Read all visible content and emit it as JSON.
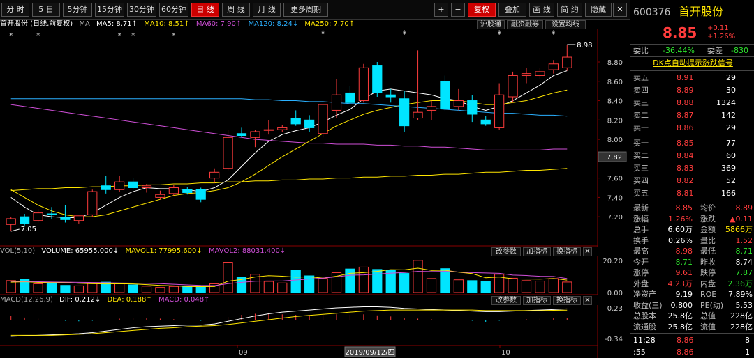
{
  "toolbar": {
    "periods": [
      "分 时",
      "5 日",
      "5分钟",
      "15分钟",
      "30分钟",
      "60分钟",
      "日 线",
      "周 线",
      "月 线",
      "更多周期"
    ],
    "active_period": "日 线",
    "right_buttons": [
      "+",
      "−",
      "复权",
      "叠加",
      "画 线",
      "简 约",
      "隐藏"
    ]
  },
  "main_header": {
    "stock_title": "首开股份 (日线,前复权)",
    "ma_label": "MA",
    "ma5": "MA5: 8.71",
    "ma10": "MA10: 8.51",
    "ma60": "MA60: 7.90",
    "ma120": "MA120: 8.24",
    "ma250": "MA250: 7.70",
    "buttons": [
      "沪股通",
      "融资融券",
      "设置均线"
    ]
  },
  "vol_header": {
    "title": "VOL(5,10)",
    "volume": "VOLUME: 65955.000",
    "mavol1": "MAVOL1: 77995.600",
    "mavol2": "MAVOL2: 88031.400",
    "buttons": [
      "改参数",
      "加指标",
      "换指标",
      "✕"
    ]
  },
  "macd_header": {
    "title": "MACD(12,26,9)",
    "dif": "DIF: 0.212",
    "dea": "DEA: 0.188",
    "macd": "MACD: 0.048",
    "buttons": [
      "改参数",
      "加指标",
      "换指标",
      "✕"
    ]
  },
  "axis": {
    "price_ticks": [
      "8.80",
      "8.60",
      "8.40",
      "8.20",
      "8.00",
      "7.80",
      "7.60",
      "7.40",
      "7.20"
    ],
    "current_tag": "7.82",
    "vol_ticks": [
      "20.20",
      "0.00"
    ],
    "macd_ticks": [
      "0.23",
      "-0.34"
    ],
    "date_labels": [
      "09",
      "10"
    ],
    "date_cursor": "2019/09/12/四",
    "high_mark": "8.98",
    "low_mark": "7.05"
  },
  "colors": {
    "up": "#ff3c3c",
    "down": "#00e5ff",
    "ma5": "#ffffff",
    "ma10": "#ffe600",
    "ma60": "#d04fd8",
    "ma120": "#2ab0ff",
    "ma250": "#ffe600"
  },
  "right_panel": {
    "code": "600376",
    "name": "首开股份",
    "price": "8.85",
    "change": "+0.11",
    "change_pct": "+1.26%",
    "weibi_label": "委比",
    "weibi": "-36.44%",
    "weicha_label": "委差",
    "weicha": "-830",
    "signal_link": "DK点自动提示涨跌信号",
    "asks": [
      {
        "label": "卖五",
        "price": "8.91",
        "vol": "29"
      },
      {
        "label": "卖四",
        "price": "8.89",
        "vol": "30"
      },
      {
        "label": "卖三",
        "price": "8.88",
        "vol": "1324"
      },
      {
        "label": "卖二",
        "price": "8.87",
        "vol": "142"
      },
      {
        "label": "卖一",
        "price": "8.86",
        "vol": "29"
      }
    ],
    "bids": [
      {
        "label": "买一",
        "price": "8.85",
        "vol": "77"
      },
      {
        "label": "买二",
        "price": "8.84",
        "vol": "60"
      },
      {
        "label": "买三",
        "price": "8.83",
        "vol": "369"
      },
      {
        "label": "买四",
        "price": "8.82",
        "vol": "52"
      },
      {
        "label": "买五",
        "price": "8.81",
        "vol": "166"
      }
    ],
    "quote": [
      {
        "l1": "最新",
        "v1": "8.85",
        "c1": "red",
        "l2": "均价",
        "v2": "8.89",
        "c2": "red"
      },
      {
        "l1": "涨幅",
        "v1": "+1.26%",
        "c1": "red",
        "l2": "涨跌",
        "v2": "▲0.11",
        "c2": "red"
      },
      {
        "l1": "总手",
        "v1": "6.60万",
        "c1": "white",
        "l2": "金额",
        "v2": "5866万",
        "c2": "yellow"
      },
      {
        "l1": "换手",
        "v1": "0.26%",
        "c1": "white",
        "l2": "量比",
        "v2": "1.52",
        "c2": "red"
      },
      {
        "l1": "最高",
        "v1": "8.98",
        "c1": "red",
        "l2": "最低",
        "v2": "8.71",
        "c2": "green"
      },
      {
        "l1": "今开",
        "v1": "8.71",
        "c1": "green",
        "l2": "昨收",
        "v2": "8.74",
        "c2": "white"
      },
      {
        "l1": "涨停",
        "v1": "9.61",
        "c1": "red",
        "l2": "跌停",
        "v2": "7.87",
        "c2": "green"
      },
      {
        "l1": "外盘",
        "v1": "4.23万",
        "c1": "red",
        "l2": "内盘",
        "v2": "2.36万",
        "c2": "green"
      },
      {
        "l1": "净资产",
        "v1": "9.19",
        "c1": "white",
        "l2": "ROE",
        "v2": "7.89%",
        "c2": "white"
      },
      {
        "l1": "收益(三)",
        "v1": "0.800",
        "c1": "white",
        "l2": "PE(动)",
        "v2": "5.53",
        "c2": "white"
      },
      {
        "l1": "总股本",
        "v1": "25.8亿",
        "c1": "white",
        "l2": "总值",
        "v2": "228亿",
        "c2": "white"
      },
      {
        "l1": "流通股",
        "v1": "25.8亿",
        "c1": "white",
        "l2": "流值",
        "v2": "228亿",
        "c2": "white"
      }
    ],
    "ticks": [
      {
        "time": "11:28",
        "price": "8.86",
        "vol": "8"
      },
      {
        "time": ":55",
        "price": "8.86",
        "vol": "1"
      }
    ]
  },
  "chart_data": {
    "type": "candlestick",
    "title": "首开股份 (日线,前复权)",
    "ylim": [
      7.05,
      9.0
    ],
    "dates_visible": [
      "09",
      "2019/09/12/四",
      "10"
    ],
    "candles": [
      {
        "o": 7.12,
        "h": 7.2,
        "l": 7.05,
        "c": 7.18
      },
      {
        "o": 7.2,
        "h": 7.23,
        "l": 7.11,
        "c": 7.13
      },
      {
        "o": 7.16,
        "h": 7.28,
        "l": 7.14,
        "c": 7.24
      },
      {
        "o": 7.23,
        "h": 7.3,
        "l": 7.18,
        "c": 7.22
      },
      {
        "o": 7.19,
        "h": 7.32,
        "l": 7.14,
        "c": 7.17
      },
      {
        "o": 7.16,
        "h": 7.21,
        "l": 7.13,
        "c": 7.21
      },
      {
        "o": 7.22,
        "h": 7.48,
        "l": 7.2,
        "c": 7.46
      },
      {
        "o": 7.52,
        "h": 7.62,
        "l": 7.44,
        "c": 7.48
      },
      {
        "o": 7.48,
        "h": 7.62,
        "l": 7.46,
        "c": 7.56
      },
      {
        "o": 7.56,
        "h": 7.6,
        "l": 7.48,
        "c": 7.5
      },
      {
        "o": 7.5,
        "h": 7.54,
        "l": 7.45,
        "c": 7.52
      },
      {
        "o": 7.4,
        "h": 7.47,
        "l": 7.38,
        "c": 7.43
      },
      {
        "o": 7.44,
        "h": 7.53,
        "l": 7.42,
        "c": 7.5
      },
      {
        "o": 7.48,
        "h": 7.51,
        "l": 7.43,
        "c": 7.45
      },
      {
        "o": 7.48,
        "h": 7.5,
        "l": 7.35,
        "c": 7.38
      },
      {
        "o": 7.6,
        "h": 7.7,
        "l": 7.55,
        "c": 7.66
      },
      {
        "o": 7.7,
        "h": 8.1,
        "l": 7.68,
        "c": 8.02
      },
      {
        "o": 8.06,
        "h": 8.12,
        "l": 8.02,
        "c": 8.04
      },
      {
        "o": 8.02,
        "h": 8.1,
        "l": 7.92,
        "c": 8.08
      },
      {
        "o": 8.1,
        "h": 8.2,
        "l": 8.05,
        "c": 8.1
      },
      {
        "o": 8.1,
        "h": 8.15,
        "l": 8.08,
        "c": 8.12
      },
      {
        "o": 8.22,
        "h": 8.3,
        "l": 8.14,
        "c": 8.16
      },
      {
        "o": 8.2,
        "h": 8.25,
        "l": 8.08,
        "c": 8.12
      },
      {
        "o": 8.06,
        "h": 8.34,
        "l": 8.02,
        "c": 8.36
      },
      {
        "o": 8.3,
        "h": 8.62,
        "l": 8.22,
        "c": 8.46
      },
      {
        "o": 8.48,
        "h": 8.55,
        "l": 8.4,
        "c": 8.38
      },
      {
        "o": 8.4,
        "h": 8.78,
        "l": 8.38,
        "c": 8.74
      },
      {
        "o": 8.76,
        "h": 8.8,
        "l": 8.44,
        "c": 8.48
      },
      {
        "o": 8.46,
        "h": 8.52,
        "l": 8.38,
        "c": 8.44
      },
      {
        "o": 8.42,
        "h": 8.5,
        "l": 8.08,
        "c": 8.14
      },
      {
        "o": 8.22,
        "h": 8.92,
        "l": 8.2,
        "c": 8.28
      },
      {
        "o": 8.3,
        "h": 8.4,
        "l": 8.2,
        "c": 8.34
      },
      {
        "o": 8.6,
        "h": 8.66,
        "l": 8.3,
        "c": 8.32
      },
      {
        "o": 8.34,
        "h": 8.52,
        "l": 8.3,
        "c": 8.4
      },
      {
        "o": 8.4,
        "h": 8.46,
        "l": 8.18,
        "c": 8.26
      },
      {
        "o": 8.2,
        "h": 8.24,
        "l": 8.14,
        "c": 8.16
      },
      {
        "o": 8.12,
        "h": 8.58,
        "l": 8.1,
        "c": 8.46
      },
      {
        "o": 8.44,
        "h": 8.7,
        "l": 8.38,
        "c": 8.66
      },
      {
        "o": 8.66,
        "h": 8.74,
        "l": 8.58,
        "c": 8.68
      },
      {
        "o": 8.66,
        "h": 8.74,
        "l": 8.62,
        "c": 8.7
      },
      {
        "o": 8.72,
        "h": 8.82,
        "l": 8.68,
        "c": 8.78
      },
      {
        "o": 8.74,
        "h": 8.98,
        "l": 8.71,
        "c": 8.85
      }
    ],
    "ma_lines": [
      {
        "name": "MA5",
        "values": [
          7.4,
          7.3,
          7.22,
          7.2,
          7.19,
          7.19,
          7.24,
          7.32,
          7.4,
          7.46,
          7.5,
          7.49,
          7.49,
          7.48,
          7.46,
          7.5,
          7.58,
          7.72,
          7.86,
          7.98,
          8.05,
          8.09,
          8.12,
          8.18,
          8.25,
          8.31,
          8.42,
          8.5,
          8.52,
          8.5,
          8.48,
          8.46,
          8.42,
          8.4,
          8.34,
          8.3,
          8.34,
          8.4,
          8.48,
          8.56,
          8.66,
          8.71
        ]
      },
      {
        "name": "MA10",
        "values": [
          7.48,
          7.4,
          7.32,
          7.26,
          7.22,
          7.2,
          7.2,
          7.22,
          7.26,
          7.3,
          7.34,
          7.38,
          7.42,
          7.44,
          7.45,
          7.47,
          7.5,
          7.56,
          7.64,
          7.73,
          7.82,
          7.9,
          7.98,
          8.06,
          8.14,
          8.2,
          8.26,
          8.3,
          8.33,
          8.36,
          8.38,
          8.4,
          8.4,
          8.4,
          8.38,
          8.36,
          8.36,
          8.38,
          8.4,
          8.44,
          8.48,
          8.51
        ]
      },
      {
        "name": "MA60",
        "values": [
          8.36,
          8.34,
          8.32,
          8.3,
          8.28,
          8.26,
          8.24,
          8.22,
          8.2,
          8.18,
          8.16,
          8.14,
          8.12,
          8.1,
          8.08,
          8.06,
          8.04,
          8.02,
          8.0,
          7.99,
          7.98,
          7.97,
          7.96,
          7.96,
          7.95,
          7.95,
          7.95,
          7.94,
          7.94,
          7.93,
          7.93,
          7.92,
          7.92,
          7.91,
          7.9,
          7.89,
          7.89,
          7.89,
          7.89,
          7.89,
          7.9,
          7.9
        ]
      },
      {
        "name": "MA120",
        "values": [
          8.42,
          8.42,
          8.42,
          8.42,
          8.42,
          8.42,
          8.42,
          8.42,
          8.42,
          8.42,
          8.42,
          8.42,
          8.42,
          8.42,
          8.42,
          8.42,
          8.42,
          8.42,
          8.41,
          8.41,
          8.4,
          8.4,
          8.39,
          8.39,
          8.38,
          8.37,
          8.37,
          8.36,
          8.35,
          8.34,
          8.33,
          8.32,
          8.31,
          8.3,
          8.29,
          8.28,
          8.27,
          8.27,
          8.26,
          8.25,
          8.25,
          8.24
        ]
      },
      {
        "name": "MA250",
        "values": [
          7.47,
          7.48,
          7.49,
          7.49,
          7.5,
          7.5,
          7.51,
          7.51,
          7.52,
          7.52,
          7.53,
          7.53,
          7.54,
          7.54,
          7.55,
          7.55,
          7.56,
          7.56,
          7.57,
          7.57,
          7.58,
          7.58,
          7.59,
          7.59,
          7.6,
          7.6,
          7.61,
          7.61,
          7.62,
          7.62,
          7.63,
          7.63,
          7.64,
          7.64,
          7.65,
          7.66,
          7.66,
          7.67,
          7.68,
          7.68,
          7.69,
          7.7
        ]
      }
    ],
    "volume": [
      7.5,
      8.2,
      5.5,
      6.0,
      4.5,
      4.2,
      5.8,
      6.5,
      5.5,
      4.8,
      4.0,
      3.2,
      3.8,
      3.5,
      3.8,
      5.5,
      19.0,
      9.5,
      11.5,
      7.0,
      6.0,
      14.0,
      10.5,
      8.8,
      12.5,
      14.8,
      16.0,
      14.5,
      14.0,
      12.0,
      20.2,
      8.8,
      15.0,
      8.0,
      7.5,
      7.0,
      11.5,
      9.0,
      7.5,
      7.2,
      8.8,
      6.6
    ],
    "mavol1": [
      6.5,
      6.8,
      6.4,
      6.3,
      6.3,
      5.8,
      5.5,
      5.4,
      5.5,
      5.4,
      5.0,
      4.5,
      4.2,
      3.8,
      3.7,
      3.8,
      7.1,
      8.2,
      9.8,
      10.6,
      10.3,
      9.7,
      9.9,
      9.1,
      10.3,
      12.1,
      12.5,
      13.3,
      14.4,
      14.3,
      15.3,
      13.9,
      14.0,
      12.8,
      11.9,
      9.3,
      9.8,
      8.6,
      8.5,
      8.4,
      8.8,
      7.8
    ],
    "mavol2": [
      7.0,
      7.0,
      6.8,
      6.6,
      6.5,
      6.4,
      6.3,
      6.2,
      6.0,
      5.9,
      5.8,
      5.6,
      5.2,
      4.8,
      4.5,
      4.4,
      5.6,
      6.4,
      7.1,
      7.3,
      7.3,
      7.9,
      8.5,
      9.1,
      9.9,
      10.9,
      11.1,
      11.6,
      12.2,
      12.6,
      13.3,
      13.2,
      13.3,
      12.9,
      12.5,
      12.3,
      12.1,
      11.0,
      10.7,
      10.2,
      10.1,
      8.8
    ],
    "vol_ylim": [
      0,
      21
    ],
    "macd_hist": [
      0.08,
      0.05,
      0.03,
      0.01,
      -0.01,
      -0.02,
      -0.01,
      0.01,
      0.03,
      0.04,
      0.04,
      0.03,
      0.02,
      0.01,
      -0.01,
      0.0,
      0.06,
      0.1,
      0.12,
      0.12,
      0.11,
      0.1,
      0.09,
      0.1,
      0.11,
      0.1,
      0.11,
      0.09,
      0.07,
      0.04,
      0.03,
      0.02,
      0.01,
      0.01,
      -0.01,
      -0.03,
      -0.01,
      0.01,
      0.02,
      0.03,
      0.04,
      0.048
    ],
    "dif": [
      -0.3,
      -0.29,
      -0.28,
      -0.27,
      -0.26,
      -0.25,
      -0.23,
      -0.2,
      -0.17,
      -0.14,
      -0.12,
      -0.11,
      -0.1,
      -0.09,
      -0.09,
      -0.07,
      -0.02,
      0.03,
      0.08,
      0.12,
      0.15,
      0.17,
      0.19,
      0.21,
      0.23,
      0.24,
      0.25,
      0.25,
      0.24,
      0.22,
      0.21,
      0.2,
      0.19,
      0.18,
      0.17,
      0.16,
      0.16,
      0.17,
      0.18,
      0.19,
      0.2,
      0.212
    ],
    "dea": [
      -0.28,
      -0.28,
      -0.28,
      -0.28,
      -0.27,
      -0.26,
      -0.25,
      -0.23,
      -0.21,
      -0.19,
      -0.17,
      -0.15,
      -0.14,
      -0.12,
      -0.11,
      -0.1,
      -0.08,
      -0.05,
      -0.02,
      0.01,
      0.04,
      0.07,
      0.09,
      0.11,
      0.13,
      0.15,
      0.17,
      0.18,
      0.19,
      0.19,
      0.19,
      0.19,
      0.19,
      0.19,
      0.19,
      0.18,
      0.18,
      0.18,
      0.18,
      0.18,
      0.185,
      0.188
    ],
    "macd_ylim": [
      -0.34,
      0.23
    ]
  }
}
